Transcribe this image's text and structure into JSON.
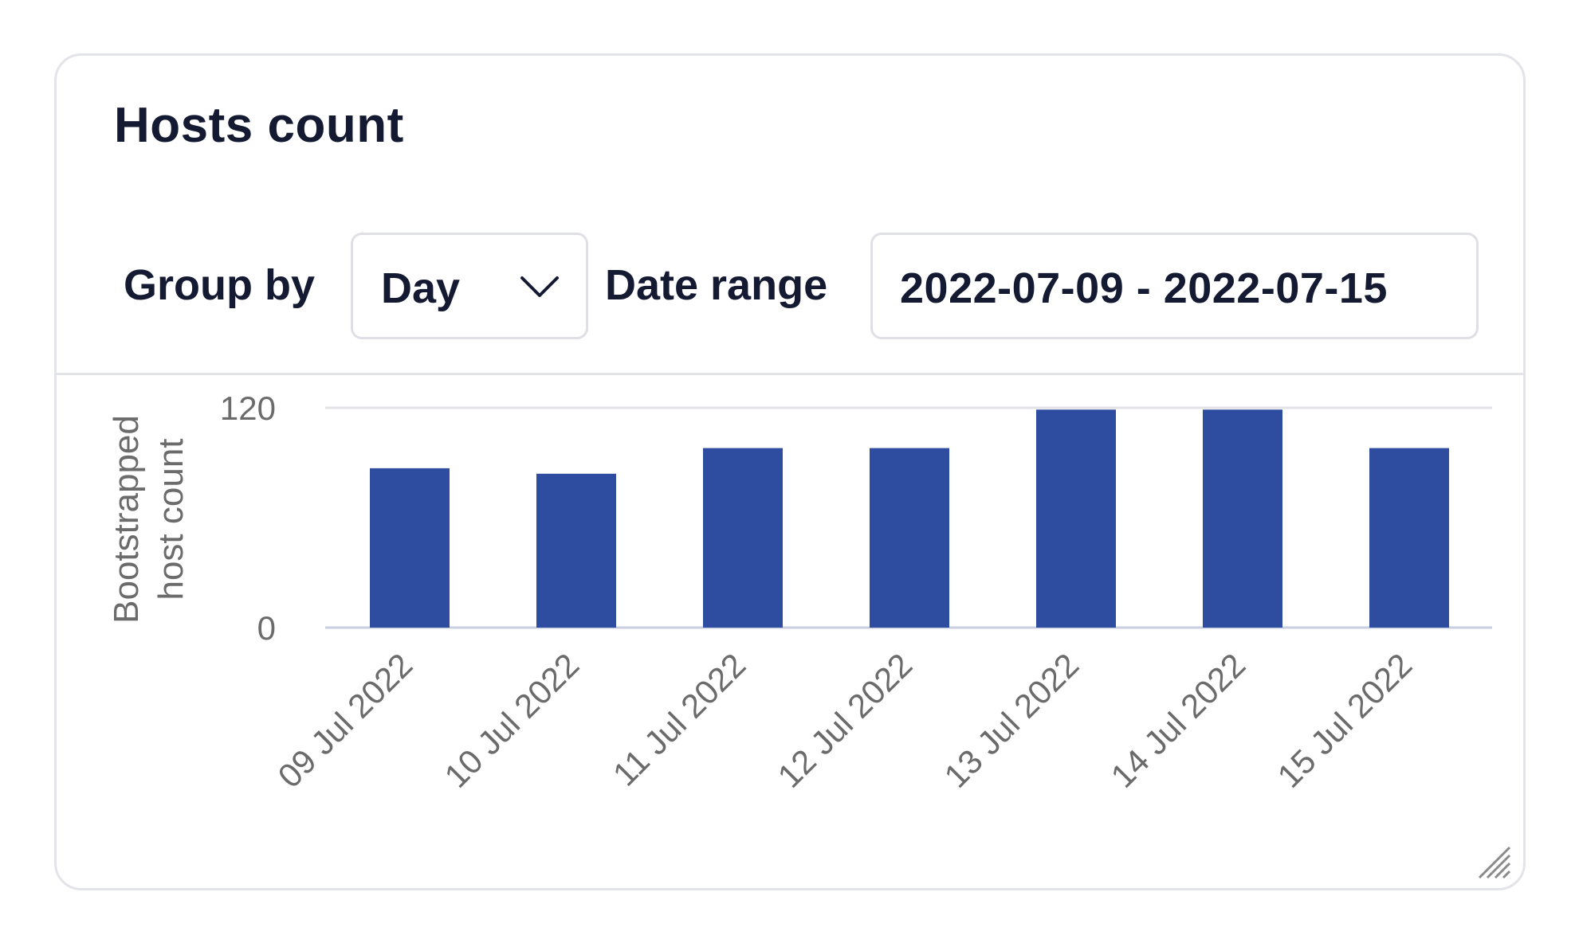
{
  "card": {
    "title": "Hosts count"
  },
  "controls": {
    "group_by_label": "Group by",
    "group_by_value": "Day",
    "date_range_label": "Date range",
    "date_range_value": "2022-07-09 - 2022-07-15"
  },
  "icons": {
    "dropdown": "chevron-down-icon",
    "resize": "resize-handle-icon"
  },
  "colors": {
    "bar": "#2f4da0",
    "text": "#151a33",
    "axis_text": "#6b6b6b",
    "gridline": "#e2e2e6",
    "baseline": "#c9cfe0"
  },
  "chart_data": {
    "type": "bar",
    "title": "",
    "xlabel": "",
    "ylabel": "Bootstrapped host count",
    "ylabel_lines": [
      "Bootstrapped",
      "host count"
    ],
    "categories": [
      "09 Jul 2022",
      "10 Jul 2022",
      "11 Jul 2022",
      "12 Jul 2022",
      "13 Jul 2022",
      "14 Jul 2022",
      "15 Jul 2022"
    ],
    "values": [
      87,
      84,
      98,
      98,
      119,
      119,
      98
    ],
    "ylim": [
      0,
      120
    ],
    "yticks": [
      0,
      120
    ],
    "grid": true,
    "legend": "none"
  }
}
